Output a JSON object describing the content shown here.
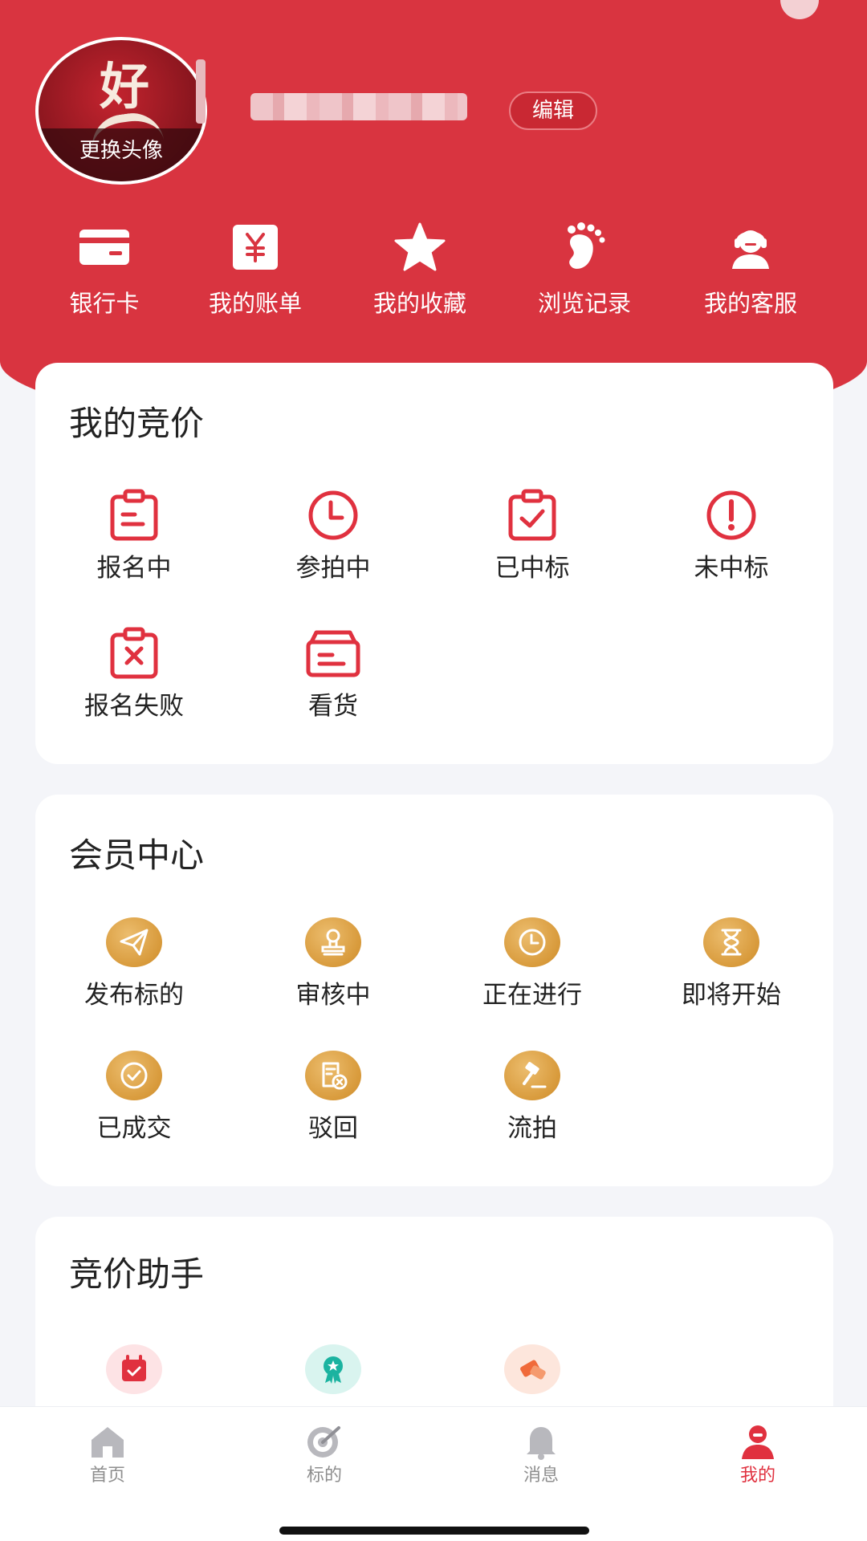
{
  "profile": {
    "avatar_change_label": "更换头像",
    "avatar_art_text": "好",
    "edit_label": "编辑"
  },
  "quick_links": [
    {
      "label": "银行卡",
      "icon": "bank-card-icon"
    },
    {
      "label": "我的账单",
      "icon": "bill-yuan-icon"
    },
    {
      "label": "我的收藏",
      "icon": "star-icon"
    },
    {
      "label": "浏览记录",
      "icon": "footprint-icon"
    },
    {
      "label": "我的客服",
      "icon": "customer-service-icon"
    }
  ],
  "bidding": {
    "title": "我的竞价",
    "items": [
      {
        "label": "报名中",
        "icon": "clipboard-icon"
      },
      {
        "label": "参拍中",
        "icon": "clock-icon"
      },
      {
        "label": "已中标",
        "icon": "clipboard-check-icon"
      },
      {
        "label": "未中标",
        "icon": "exclamation-circle-icon"
      },
      {
        "label": "报名失败",
        "icon": "clipboard-x-icon"
      },
      {
        "label": "看货",
        "icon": "box-icon"
      }
    ]
  },
  "member": {
    "title": "会员中心",
    "items": [
      {
        "label": "发布标的",
        "icon": "paper-plane-icon"
      },
      {
        "label": "审核中",
        "icon": "stamp-icon"
      },
      {
        "label": "正在进行",
        "icon": "clock-icon"
      },
      {
        "label": "即将开始",
        "icon": "hourglass-icon"
      },
      {
        "label": "已成交",
        "icon": "check-circle-icon"
      },
      {
        "label": "驳回",
        "icon": "document-x-icon"
      },
      {
        "label": "流拍",
        "icon": "gavel-icon"
      }
    ]
  },
  "assistant": {
    "title": "竞价助手",
    "items": [
      {
        "icon": "calendar-check-icon",
        "color": "#e0313f"
      },
      {
        "icon": "award-badge-icon",
        "color": "#1bb3a0"
      },
      {
        "icon": "tag-icon",
        "color": "#f06a3a"
      }
    ]
  },
  "tabs": [
    {
      "label": "首页",
      "icon": "home-icon"
    },
    {
      "label": "标的",
      "icon": "target-icon"
    },
    {
      "label": "消息",
      "icon": "bell-icon"
    },
    {
      "label": "我的",
      "icon": "user-icon",
      "active": true
    }
  ],
  "colors": {
    "brand_red": "#d93440",
    "accent_red": "#e0313f",
    "gold": "#d89a3b"
  }
}
